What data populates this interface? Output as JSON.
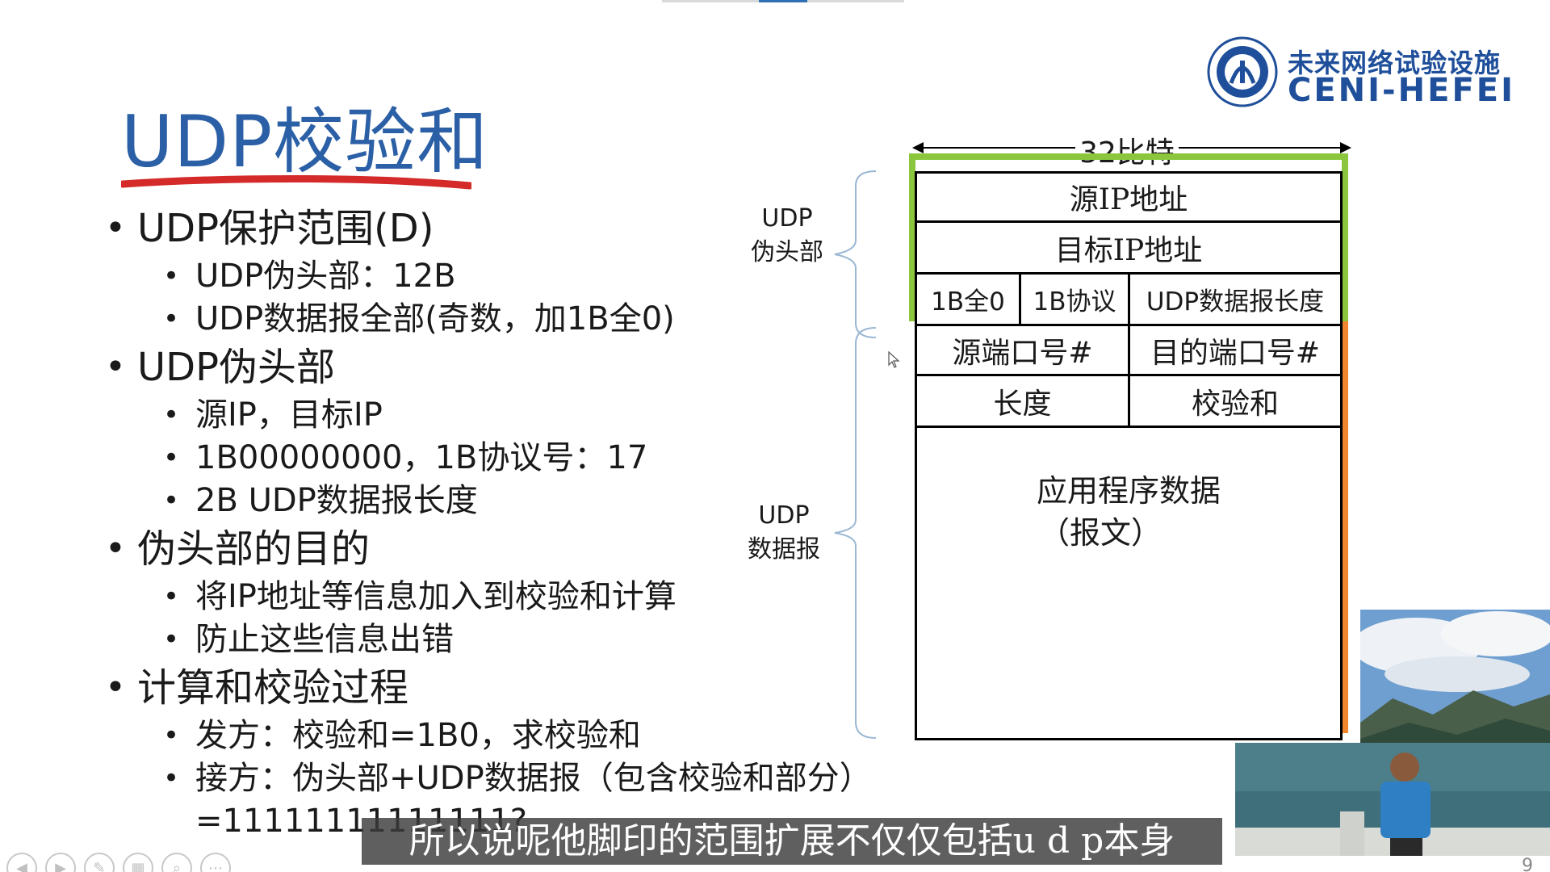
{
  "slide": {
    "title": "UDP校验和",
    "page_number": "9"
  },
  "logo": {
    "cn": "未来网络试验设施",
    "en": "CENI-HEFEI"
  },
  "bullets": [
    {
      "text": "UDP保护范围(D)",
      "sub": [
        "UDP伪头部：12B",
        "UDP数据报全部(奇数，加1B全0)"
      ]
    },
    {
      "text": "UDP伪头部",
      "sub": [
        "源IP，目标IP",
        "1B00000000，1B协议号：17",
        "2B UDP数据报长度"
      ]
    },
    {
      "text": "伪头部的目的",
      "sub": [
        "将IP地址等信息加入到校验和计算",
        "防止这些信息出错"
      ]
    },
    {
      "text": "计算和校验过程",
      "sub": [
        "发方：校验和=1B0，求校验和",
        "接方：伪头部+UDP数据报（包含校验和部分）=11111111111111?"
      ]
    }
  ],
  "diagram": {
    "width_label": "32比特",
    "pseudo_label_1": "UDP",
    "pseudo_label_2": "伪头部",
    "datagram_label_1": "UDP",
    "datagram_label_2": "数据报",
    "rows": {
      "src_ip": "源IP地址",
      "dst_ip": "目标IP地址",
      "zero": "1B全0",
      "proto": "1B协议",
      "udp_len": "UDP数据报长度",
      "src_port": "源端口号#",
      "dst_port": "目的端口号#",
      "length": "长度",
      "checksum": "校验和",
      "app_data_1": "应用程序数据",
      "app_data_2": "（报文）"
    },
    "colors": {
      "pseudo_header": "#8cc63f",
      "datagram": "#f0852e"
    }
  },
  "subtitle": "所以说呢他脚印的范围扩展不仅仅包括u d p本身",
  "nav": {
    "prev_icon": "prev-icon",
    "next_icon": "next-icon",
    "pen_icon": "pen-icon",
    "slides_icon": "slides-icon",
    "zoom_icon": "zoom-icon",
    "more_icon": "more-icon"
  }
}
